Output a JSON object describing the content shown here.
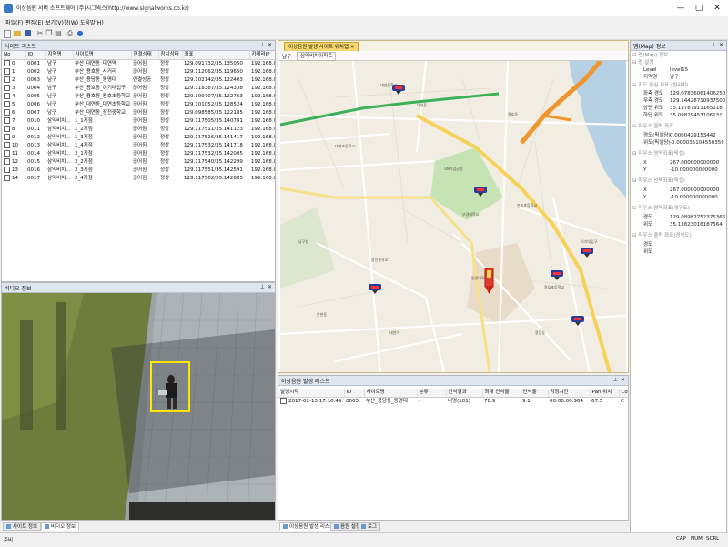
{
  "window": {
    "title": "이상음원 서버 소프트웨어 (주)시그웍스(http://www.signalworks.co.kr)",
    "minimize": "—",
    "maximize": "▢",
    "close": "✕"
  },
  "menu": [
    "파일(F)",
    "편집(E)",
    "보기(V)",
    "창(W)",
    "도움말(H)"
  ],
  "toolbar": [
    "new-icon",
    "open-icon",
    "save-icon",
    "cut-icon",
    "copy-icon",
    "paste-icon",
    "print-icon",
    "help-icon"
  ],
  "site_list": {
    "title": "사이트 리스트",
    "columns": [
      "No",
      "ID",
      "지역명",
      "사이트명",
      "연결상태",
      "장치상태",
      "좌표",
      "카메라IP"
    ],
    "rows": [
      [
        "0",
        "0001",
        "남구",
        "부산_대연동_대연역",
        "끊어짐",
        "정상",
        "129.091732/35.135050",
        "192.168.0.1"
      ],
      [
        "1",
        "0002",
        "남구",
        "부산_용호동_사거리",
        "끊어짐",
        "정상",
        "129.112062/35.119650",
        "192.168.0.1"
      ],
      [
        "2",
        "0003",
        "남구",
        "부산_용당동_동명대",
        "연결성공",
        "정상",
        "129.102142/35.122403",
        "192.168.0.1"
      ],
      [
        "3",
        "0004",
        "남구",
        "부산_용호동_이기대입구",
        "끊어짐",
        "정상",
        "129.118387/35.124338",
        "192.168.0.1"
      ],
      [
        "4",
        "0005",
        "남구",
        "부산_용호동_용호초등학교",
        "끊어짐",
        "정상",
        "129.109707/35.122763",
        "192.168.0.1"
      ],
      [
        "5",
        "0006",
        "남구",
        "부산_대연동_대연초등학교",
        "끊어짐",
        "정상",
        "129.101052/35.128524",
        "192.168.0.1"
      ],
      [
        "6",
        "0007",
        "남구",
        "부산_대연동_장전중학교",
        "끊어짐",
        "정상",
        "129.098585/35.122185",
        "192.168.0.1"
      ],
      [
        "7",
        "0010",
        "삼익비치...",
        "1_1지점",
        "끊어짐",
        "정상",
        "129.117505/35.140781",
        "192.168.0.1"
      ],
      [
        "8",
        "0011",
        "삼익비치...",
        "1_2지점",
        "끊어짐",
        "정상",
        "129.117511/35.141123",
        "192.168.0.1"
      ],
      [
        "9",
        "0012",
        "삼익비치...",
        "1_3지점",
        "끊어짐",
        "정상",
        "129.117516/35.141417",
        "192.168.0.1"
      ],
      [
        "10",
        "0013",
        "삼익비치...",
        "1_4지점",
        "끊어짐",
        "정상",
        "129.117532/35.141718",
        "192.168.0.1"
      ],
      [
        "11",
        "0014",
        "삼익비치...",
        "2_1지점",
        "끊어짐",
        "정상",
        "129.117532/35.142005",
        "192.168.0.1"
      ],
      [
        "12",
        "0015",
        "삼익비치...",
        "2_2지점",
        "끊어짐",
        "정상",
        "129.117540/35.142299",
        "192.168.0.1"
      ],
      [
        "13",
        "0016",
        "삼익비치...",
        "2_3지점",
        "끊어짐",
        "정상",
        "129.117551/35.142591",
        "192.168.0.1"
      ],
      [
        "14",
        "0017",
        "삼익비치...",
        "2_4지점",
        "끊어짐",
        "정상",
        "129.117562/35.142885",
        "192.168.0.1"
      ]
    ]
  },
  "video": {
    "title": "비디오 정보"
  },
  "left_tabs": [
    "사이트 정보",
    "비디오 정보"
  ],
  "map": {
    "tab_label": "이상음원 발생 사이트 위치맵",
    "region": "남구",
    "sub_tab": "삼익비치아파트"
  },
  "event_list": {
    "title": "이상음원 발생 리스트",
    "columns": [
      "발생시각",
      "ID",
      "사이트명",
      "분류",
      "인식결과",
      "최대 인식율",
      "인식율",
      "지정시간",
      "Pan 위치",
      "Co"
    ],
    "rows": [
      [
        "2017-02-13 17:10:49.716",
        "0003",
        "부산_용당동_동명대",
        "-",
        "비명(101)",
        "78.9",
        "9.1",
        "00:00:00.984",
        "67.5",
        "C"
      ]
    ]
  },
  "bottom_tabs": [
    "이상음원 발생 리스트",
    "음원 설정",
    "로그"
  ],
  "props": {
    "title": "맵(Map) 정보",
    "sections": {
      "map_info": "맵(Map) 정보",
      "map_settings": "맵 설정",
      "map_scale": "지도 중심 좌표 (원위치)",
      "coord": "마우스 클릭 좌표",
      "area_pixel": "마우스 영역좌표(픽셀)",
      "area_pixel2": "마우스 선택좌표(픽셀)",
      "area_geo": "마우스 영역좌표(경위도)",
      "area_geo2": "마우스 클릭 좌표(경위도)"
    },
    "level_label": "Level",
    "level_value": "level15",
    "region_label": "지역명",
    "region_value": "남구",
    "rows1": [
      [
        "좌측 경도",
        "129.07836061406250"
      ],
      [
        "우측 경도",
        "129.14428710937500"
      ],
      [
        "상단 위도",
        "35.13787911165118"
      ],
      [
        "하단 위도",
        "35.09829453106131"
      ]
    ],
    "rows2": [
      [
        "경도(픽셀당)",
        "0.0000429153442"
      ],
      [
        "위도(픽셀당)",
        "-0.000035104550359"
      ]
    ],
    "rows3": [
      [
        "X",
        "267.000000000000"
      ],
      [
        "Y",
        "-10.000000000000"
      ]
    ],
    "rows4": [
      [
        "X",
        "267.000000000000"
      ],
      [
        "Y",
        "-10.000000000000"
      ]
    ],
    "rows5": [
      [
        "경도",
        "129.08982752375366"
      ],
      [
        "위도",
        "35.13823016187564"
      ]
    ],
    "rows6": [
      [
        "경도",
        ""
      ],
      [
        "위도",
        ""
      ]
    ]
  },
  "status": {
    "left": "준비",
    "caps": "CAP",
    "num": "NUM",
    "scrl": "SCRL"
  },
  "colors": {
    "panel_header": "#dfe6ee",
    "map_tab": "#f6d86a",
    "road_orange": "#f0962e",
    "road_green": "#3db05a",
    "marker_red": "#d02020"
  }
}
